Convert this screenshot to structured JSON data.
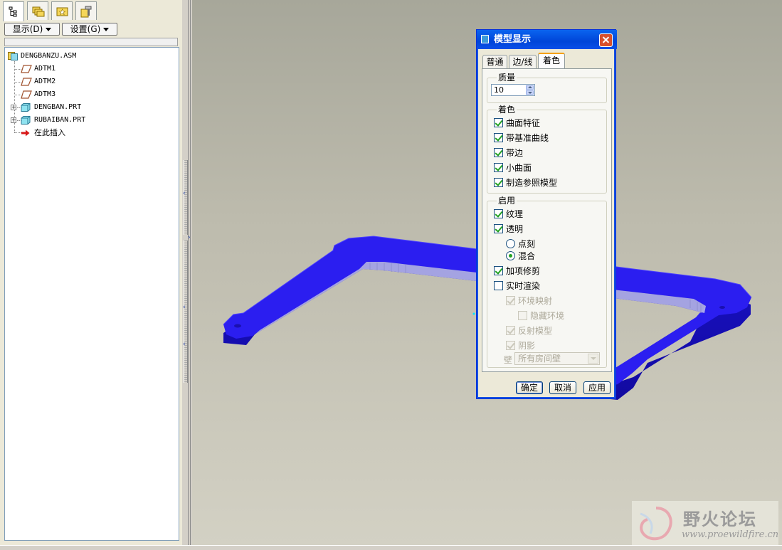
{
  "left_panel": {
    "toolbar": {
      "display_label": "显示(D)",
      "settings_label": "设置(G)"
    },
    "tabs": [
      {
        "icon": "model-tree-icon"
      },
      {
        "icon": "folder-browser-icon"
      },
      {
        "icon": "favorites-icon"
      },
      {
        "icon": "connections-icon"
      }
    ],
    "tree": {
      "root": "DENGBANZU.ASM",
      "items": [
        {
          "label": "ADTM1",
          "icon": "datum-plane-icon",
          "expandable": false
        },
        {
          "label": "ADTM2",
          "icon": "datum-plane-icon",
          "expandable": false
        },
        {
          "label": "ADTM3",
          "icon": "datum-plane-icon",
          "expandable": false
        },
        {
          "label": "DENGBAN.PRT",
          "icon": "part-icon",
          "expandable": true
        },
        {
          "label": "RUBAIBAN.PRT",
          "icon": "part-icon",
          "expandable": true
        },
        {
          "label": "在此插入",
          "icon": "insert-here-icon",
          "expandable": false
        }
      ]
    }
  },
  "dialog": {
    "title": "模型显示",
    "tabs": [
      "普通",
      "边/线",
      "着色"
    ],
    "active_tab": "着色",
    "quality": {
      "label": "质量",
      "value": "10"
    },
    "shading": {
      "label": "着色",
      "options": [
        {
          "label": "曲面特征",
          "checked": true
        },
        {
          "label": "带基准曲线",
          "checked": true
        },
        {
          "label": "带边",
          "checked": true
        },
        {
          "label": "小曲面",
          "checked": true
        },
        {
          "label": "制造参照模型",
          "checked": true
        }
      ]
    },
    "enable": {
      "label": "启用",
      "texture": {
        "label": "纹理",
        "checked": true
      },
      "transparency": {
        "label": "透明",
        "checked": true
      },
      "transparency_modes": [
        {
          "label": "点刻",
          "selected": false
        },
        {
          "label": "混合",
          "selected": true
        }
      ],
      "addon_trim": {
        "label": "加项修剪",
        "checked": true
      },
      "realtime_render": {
        "label": "实时渲染",
        "checked": false
      },
      "env_mapping": {
        "label": "环境映射",
        "checked": true,
        "disabled": true
      },
      "hide_env": {
        "label": "隐藏环境",
        "checked": false,
        "disabled": true
      },
      "reflect_model": {
        "label": "反射模型",
        "checked": true,
        "disabled": true
      },
      "shadow": {
        "label": "阴影",
        "checked": true,
        "disabled": true
      },
      "wall": {
        "label": "壁",
        "value": "所有房间壁",
        "disabled": true
      }
    },
    "buttons": {
      "ok": "确定",
      "cancel": "取消",
      "apply": "应用"
    }
  },
  "viewport": {
    "model_color": "#2b1ef0"
  },
  "watermark": {
    "text": "野火论坛",
    "url": "www.proewildfire.cn"
  }
}
